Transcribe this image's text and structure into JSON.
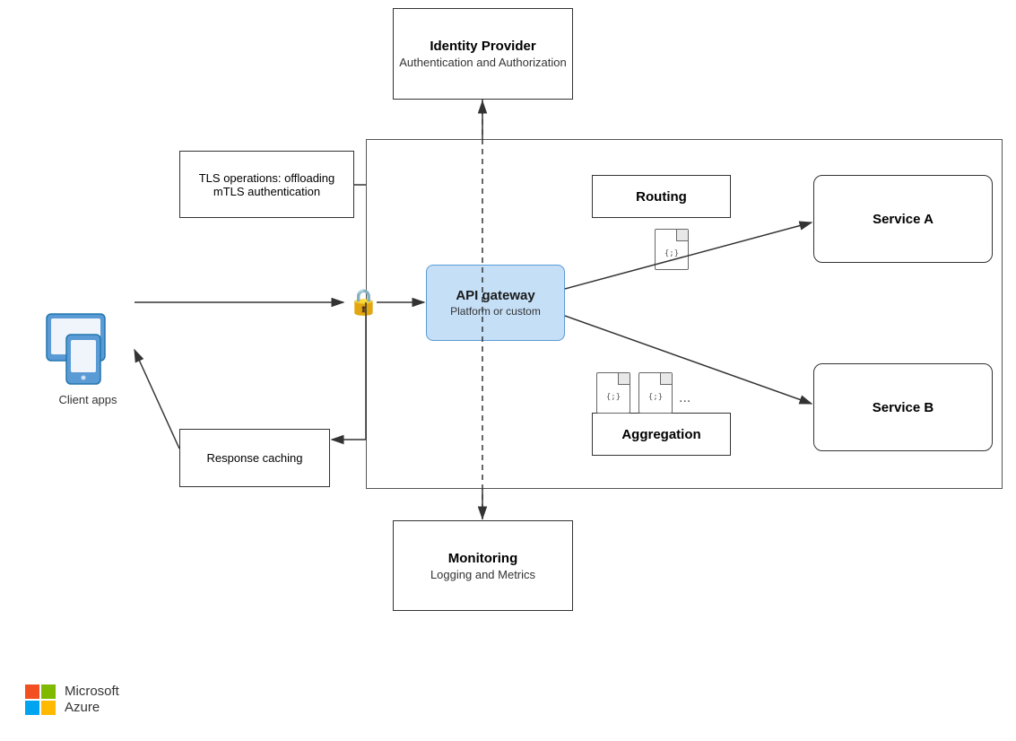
{
  "identity": {
    "title": "Identity Provider",
    "subtitle": "Authentication and Authorization"
  },
  "monitoring": {
    "title": "Monitoring",
    "subtitle": "Logging and Metrics"
  },
  "tls": {
    "label": "TLS operations: offloading mTLS authentication"
  },
  "response": {
    "label": "Response caching"
  },
  "api_gateway": {
    "title": "API gateway",
    "subtitle": "Platform or custom"
  },
  "routing": {
    "label": "Routing"
  },
  "aggregation": {
    "label": "Aggregation"
  },
  "service_a": {
    "label": "Service A"
  },
  "service_b": {
    "label": "Service B"
  },
  "client": {
    "label": "Client apps"
  },
  "azure": {
    "line1": "Microsoft",
    "line2": "Azure"
  }
}
